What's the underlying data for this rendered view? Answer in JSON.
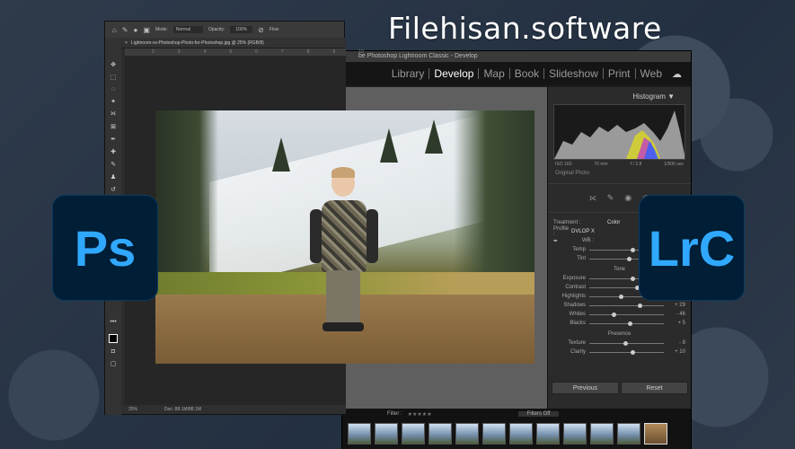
{
  "watermark": "Filehisan.software",
  "lightroom": {
    "title": "be Photoshop Lightroom Classic - Develop",
    "modules": [
      "Library",
      "Develop",
      "Map",
      "Book",
      "Slideshow",
      "Print",
      "Web"
    ],
    "active_module": "Develop",
    "histogram_title": "Histogram",
    "hist_info": [
      "ISO 160",
      "70 mm",
      "f / 2.8",
      "1/500 sec"
    ],
    "original_photo": "Original Photo",
    "treatment_label": "Treatment :",
    "treatment_value": "Color",
    "profile_label": "Profile :",
    "profile_value": "DVLOP X",
    "wb_label": "WB :",
    "basic_rows": [
      {
        "label": "Temp",
        "value": "",
        "pos": 0.55
      },
      {
        "label": "Tint",
        "value": "",
        "pos": 0.5
      }
    ],
    "tone_title": "Tone",
    "tone_rows": [
      {
        "label": "Exposure",
        "value": "+ 0.10",
        "pos": 0.55
      },
      {
        "label": "Contrast",
        "value": "+ 20",
        "pos": 0.62
      },
      {
        "label": "Highlights",
        "value": "- 36",
        "pos": 0.4
      },
      {
        "label": "Shadows",
        "value": "+ 29",
        "pos": 0.65
      },
      {
        "label": "Whites",
        "value": "- 46",
        "pos": 0.3
      },
      {
        "label": "Blacks",
        "value": "+ 5",
        "pos": 0.52
      }
    ],
    "presence_title": "Presence",
    "presence_rows": [
      {
        "label": "Texture",
        "value": "- 8",
        "pos": 0.46
      },
      {
        "label": "Clarity",
        "value": "+ 10",
        "pos": 0.56
      }
    ],
    "previous_button": "Previous",
    "reset_button": "Reset",
    "filter_label": "Filter :",
    "filters_off": "Filters Off"
  },
  "photoshop": {
    "doc_tab": "Lightroom-vs-Photoshop-Photo-for-Photoshop.jpg @ 25% (RGB/8)",
    "mode_label": "Mode:",
    "mode_value": "Normal",
    "opacity_label": "Opacity:",
    "opacity_value": "100%",
    "flow_label": "Flow",
    "ruler": [
      "2",
      "3",
      "4",
      "5",
      "6",
      "7",
      "8",
      "9",
      "10"
    ],
    "zoom": "25%",
    "doc_size": "Doc: 88.1M/88.1M"
  },
  "logos": {
    "ps": "Ps",
    "lrc": "LrC"
  },
  "colors": {
    "logo_bg": "#001e36",
    "logo_text": "#31a8ff"
  }
}
